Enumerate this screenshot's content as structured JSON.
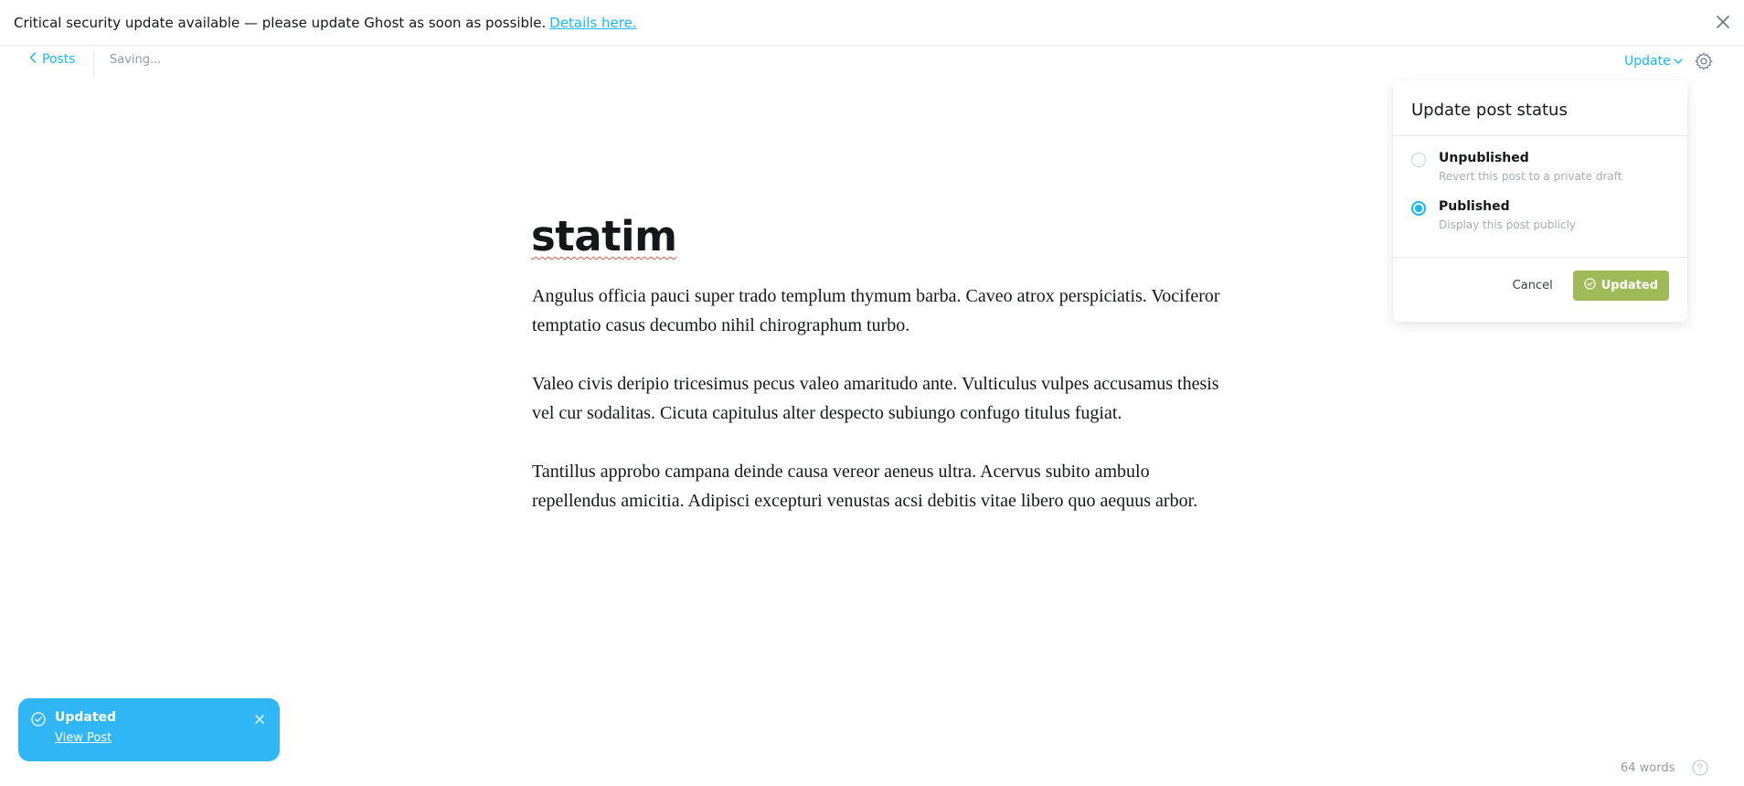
{
  "banner": {
    "message": "Critical security update available — please update Ghost as soon as possible.",
    "link_label": "Details here."
  },
  "header": {
    "back_label": "Posts",
    "status": "Saving...",
    "update_label": "Update"
  },
  "post": {
    "title": "statim",
    "paragraphs": [
      "Angulus officia pauci super trado templum thymum barba. Caveo atrox perspiciatis. Vociferor temptatio casus decumbo nihil chirographum turbo.",
      "Valeo civis deripio tricesimus pecus valeo amaritudo ante. Vulticulus vulpes accusamus thesis vel cur sodalitas. Cicuta capitulus alter despecto subiungo confugo titulus fugiat.",
      "Tantillus approbo campana deinde causa vereor aeneus ultra. Acervus subito ambulo repellendus amicitia. Adipisci excepturi venustas acsi debitis vitae libero quo aequus arbor."
    ]
  },
  "publish_menu": {
    "title": "Update post status",
    "options": [
      {
        "label": "Unpublished",
        "description": "Revert this post to a private draft",
        "selected": false
      },
      {
        "label": "Published",
        "description": "Display this post publicly",
        "selected": true
      }
    ],
    "cancel_label": "Cancel",
    "confirm_label": "Updated"
  },
  "toast": {
    "title": "Updated",
    "link_label": "View Post"
  },
  "footer": {
    "word_count": "64 words"
  },
  "colors": {
    "accent": "#14b8ff",
    "success": "#9fbb58",
    "toast_bg": "#30b6f5"
  }
}
